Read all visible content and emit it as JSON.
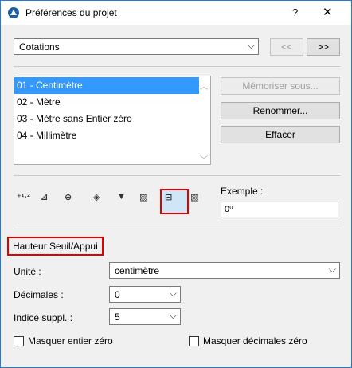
{
  "window": {
    "title": "Préférences du projet",
    "help": "?",
    "close": "✕"
  },
  "top": {
    "category_value": "Cotations",
    "prev_label": "<<",
    "next_label": ">>"
  },
  "list": {
    "items": [
      "01 - Centimètre",
      "02 - Mètre",
      "03 - Mètre sans Entier zéro",
      "04 - Millimètre"
    ],
    "selected_index": 0
  },
  "actions": {
    "save_label": "Mémoriser sous...",
    "rename_label": "Renommer...",
    "delete_label": "Effacer"
  },
  "dimension_icons": [
    {
      "name": "linear-dimension-icon",
      "glyph": "⁺¹·²"
    },
    {
      "name": "angular-dimension-icon",
      "glyph": "⊿"
    },
    {
      "name": "radial-dimension-icon",
      "glyph": "⊕"
    },
    {
      "name": "level-dimension-icon",
      "glyph": "◈"
    },
    {
      "name": "elevation-dimension-icon",
      "glyph": "▼"
    },
    {
      "name": "door-window-dimension-icon",
      "glyph": "▨"
    },
    {
      "name": "sill-height-dimension-icon",
      "glyph": "⊟"
    },
    {
      "name": "area-dimension-icon",
      "glyph": "▧"
    }
  ],
  "example": {
    "label": "Exemple :",
    "value": "0⁰"
  },
  "section": {
    "title": "Hauteur Seuil/Appui",
    "unit_label": "Unité :",
    "unit_value": "centimètre",
    "decimals_label": "Décimales :",
    "decimals_value": "0",
    "extra_index_label": "Indice suppl. :",
    "extra_index_value": "5",
    "hide_integer_zero_label": "Masquer entier zéro",
    "hide_decimal_zero_label": "Masquer décimales zéro"
  },
  "colors": {
    "accent": "#3399ff",
    "highlight": "#e00000",
    "titlebar_border": "#1e7cd6"
  }
}
